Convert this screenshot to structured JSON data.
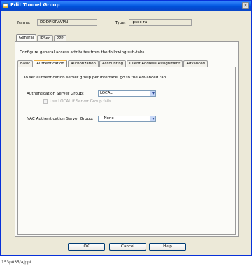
{
  "window": {
    "title": "Edit Tunnel Group",
    "close_glyph": "✕"
  },
  "header": {
    "name_label": "Name:",
    "name_value": "DODPKIRAVPN",
    "type_label": "Type:",
    "type_value": "ipsec-ra"
  },
  "top_tabs": [
    {
      "label": "General"
    },
    {
      "label": "IPSec"
    },
    {
      "label": "PPP"
    }
  ],
  "general": {
    "description": "Configure general access attributes from the following sub-tabs.",
    "sub_tabs": [
      {
        "label": "Basic"
      },
      {
        "label": "Authentication"
      },
      {
        "label": "Authorization"
      },
      {
        "label": "Accounting"
      },
      {
        "label": "Client Address Assignment"
      },
      {
        "label": "Advanced"
      }
    ]
  },
  "authentication": {
    "note": "To set authentication server group per interface, go to the Advanced tab.",
    "server_group_label": "Authentication Server Group:",
    "server_group_value": "LOCAL",
    "use_local_label": "Use LOCAL if Server Group fails",
    "use_local_checked": false,
    "nac_label": "NAC Authentication Server Group:",
    "nac_value": "-- None --"
  },
  "buttons": {
    "ok": "OK",
    "cancel": "Cancel",
    "help": "Help"
  },
  "caption": "153p035/a/ppt",
  "colors": {
    "titlebar": "#0a5fe6",
    "dialog_bg": "#ece9d8",
    "panel_bg": "#fbfbf8",
    "active_tab_accent": "#f2b443"
  }
}
